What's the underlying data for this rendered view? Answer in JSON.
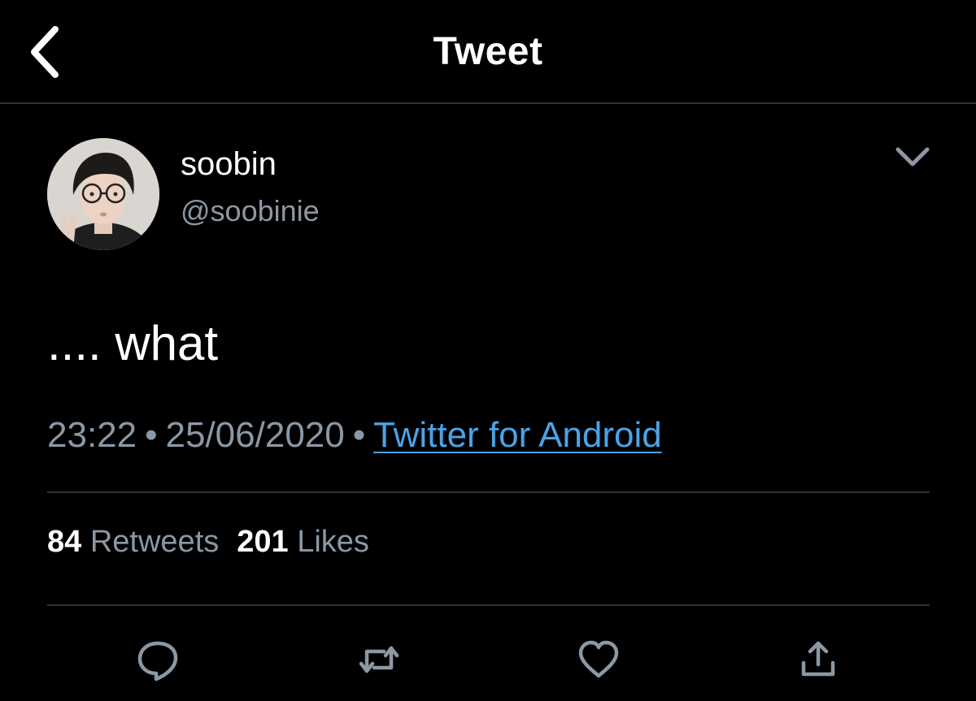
{
  "header": {
    "title": "Tweet",
    "back_icon": "chevron-left-icon"
  },
  "tweet": {
    "display_name": "soobin",
    "handle": "@soobinie",
    "text": ".... what",
    "time": "23:22",
    "date": "25/06/2020",
    "separator": "•",
    "source": "Twitter for Android",
    "more_icon": "chevron-down-icon"
  },
  "stats": {
    "retweets_count": "84",
    "retweets_label": "Retweets",
    "likes_count": "201",
    "likes_label": "Likes"
  },
  "actions": [
    {
      "name": "reply",
      "icon": "reply-icon"
    },
    {
      "name": "retweet",
      "icon": "retweet-icon"
    },
    {
      "name": "like",
      "icon": "heart-icon"
    },
    {
      "name": "share",
      "icon": "share-icon"
    }
  ],
  "colors": {
    "background": "#000000",
    "text_primary": "#ffffff",
    "text_secondary": "#8b98a5",
    "link": "#4aa3e8",
    "divider": "#2f3336"
  }
}
